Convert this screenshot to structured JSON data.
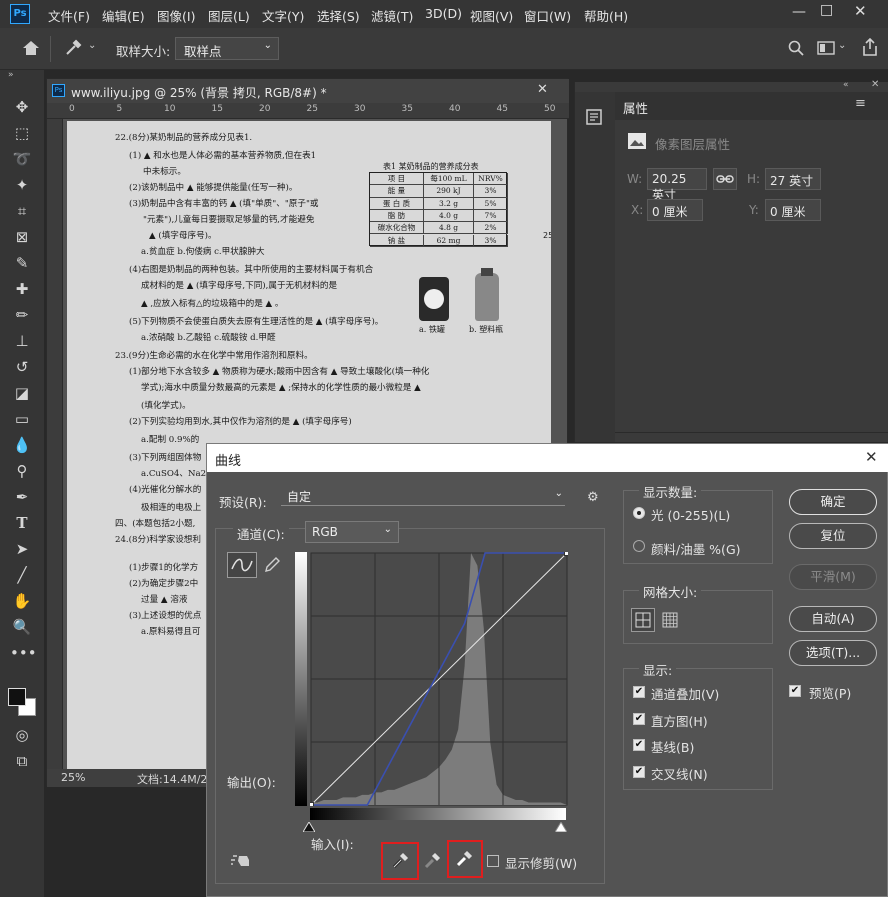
{
  "menu": {
    "logo": "Ps",
    "items": [
      "文件(F)",
      "编辑(E)",
      "图像(I)",
      "图层(L)",
      "文字(Y)",
      "选择(S)",
      "滤镜(T)",
      "3D(D)",
      "视图(V)",
      "窗口(W)",
      "帮助(H)"
    ]
  },
  "options": {
    "sample_size_label": "取样大小:",
    "sample_size_value": "取样点"
  },
  "document": {
    "tab_title": "www.iliyu.jpg @ 25% (背景 拷贝, RGB/8#) *",
    "ruler_ticks": [
      "0",
      "5",
      "10",
      "15",
      "20",
      "25",
      "30",
      "35",
      "40",
      "45",
      "50"
    ],
    "zoom": "25%",
    "doc_size": "文档:14.4M/28",
    "paper_lines": [
      "22.(8分)某奶制品的营养成分见表1.",
      "(1) ▲ 和水也是人体必需的基本营养物质,但在表1",
      "中未标示。",
      "(2)该奶制品中 ▲ 能够提供能量(任写一种)。",
      "(3)奶制品中含有丰富的钙 ▲ (填\"单质\"、\"原子\"或",
      "\"元素\"),儿童每日要摄取足够量的钙,才能避免",
      "▲ (填字母序号)。",
      "a.贫血症    b.佝偻病    c.甲状腺肿大",
      "(4)右图是奶制品的两种包装。其中所使用的主要材料属于有机合",
      "成材料的是 ▲ (填字母序号,下同),属于无机材料的是",
      "▲ ,应放入标有△的垃圾箱中的是 ▲ 。",
      "(5)下列物质不会使蛋白质失去原有生理活性的是 ▲ (填字母序号)。",
      "a.浓硝酸    b.乙酸铅    c.硫酸铵    d.甲醛",
      "23.(9分)生命必需的水在化学中常用作溶剂和原料。",
      "(1)部分地下水含较多 ▲ 物质称为硬水;酸雨中因含有 ▲ 导致土壤酸化(填一种化",
      "学式);海水中质量分数最高的元素是 ▲ ;保持水的化学性质的最小微粒是 ▲",
      "(填化学式)。",
      "(2)下列实验均用到水,其中仅作为溶剂的是 ▲ (填字母序号)",
      "a.配制 0.9%的",
      "(3)下列两组固体物",
      "a.CuSO4、Na2SO",
      "(4)光催化分解水的",
      "极相连的电极上",
      "四、(本题包括2小题,",
      "24.(8分)科学家设想利",
      "(1)步骤1的化学方",
      "(2)为确定步骤2中",
      "过量 ▲ 溶液",
      "(3)上述设想的优点",
      "a.原料易得且可"
    ],
    "table_title": "表1  某奶制品的营养成分表",
    "table_header": [
      "项  目",
      "每100 mL",
      "NRV%"
    ],
    "table_rows": [
      [
        "能  量",
        "290 kJ",
        "3%"
      ],
      [
        "蛋 白 质",
        "3.2 g",
        "5%"
      ],
      [
        "脂  肪",
        "4.0 g",
        "7%"
      ],
      [
        "碳水化合物",
        "4.8 g",
        "2%"
      ],
      [
        "钠  盐",
        "62 mg",
        "3%"
      ]
    ],
    "img_label_a": "a. 铁罐",
    "img_label_b": "b. 塑料瓶",
    "margin_number": "25"
  },
  "properties": {
    "tab": "属性",
    "subtitle": "像素图层属性",
    "w_label": "W:",
    "w_value": "20.25 英寸",
    "h_label": "H:",
    "h_value": "27 英寸",
    "x_label": "X:",
    "x_value": "0 厘米",
    "y_label": "Y:",
    "y_value": "0 厘米"
  },
  "curves": {
    "title": "曲线",
    "preset_label": "预设(R):",
    "preset_value": "自定",
    "channel_label": "通道(C):",
    "channel_value": "RGB",
    "output_label": "输出(O):",
    "input_label": "输入(I):",
    "show_clipping": "显示修剪(W)",
    "show_amount_title": "显示数量:",
    "light_option": "光 (0-255)(L)",
    "pigment_option": "颜料/油墨 %(G)",
    "grid_size_title": "网格大小:",
    "display_title": "显示:",
    "display_options": [
      "通道叠加(V)",
      "直方图(H)",
      "基线(B)",
      "交叉线(N)"
    ],
    "buttons": {
      "ok": "确定",
      "reset": "复位",
      "smooth": "平滑(M)",
      "auto": "自动(A)",
      "options": "选项(T)..."
    },
    "preview": "预览(P)",
    "accent_red": "#e01e1e",
    "curve_blue": "#3a4fb0",
    "curve_points": [
      [
        0,
        0
      ],
      [
        22,
        0
      ],
      [
        60,
        72
      ],
      [
        68,
        100
      ],
      [
        100,
        100
      ]
    ]
  }
}
